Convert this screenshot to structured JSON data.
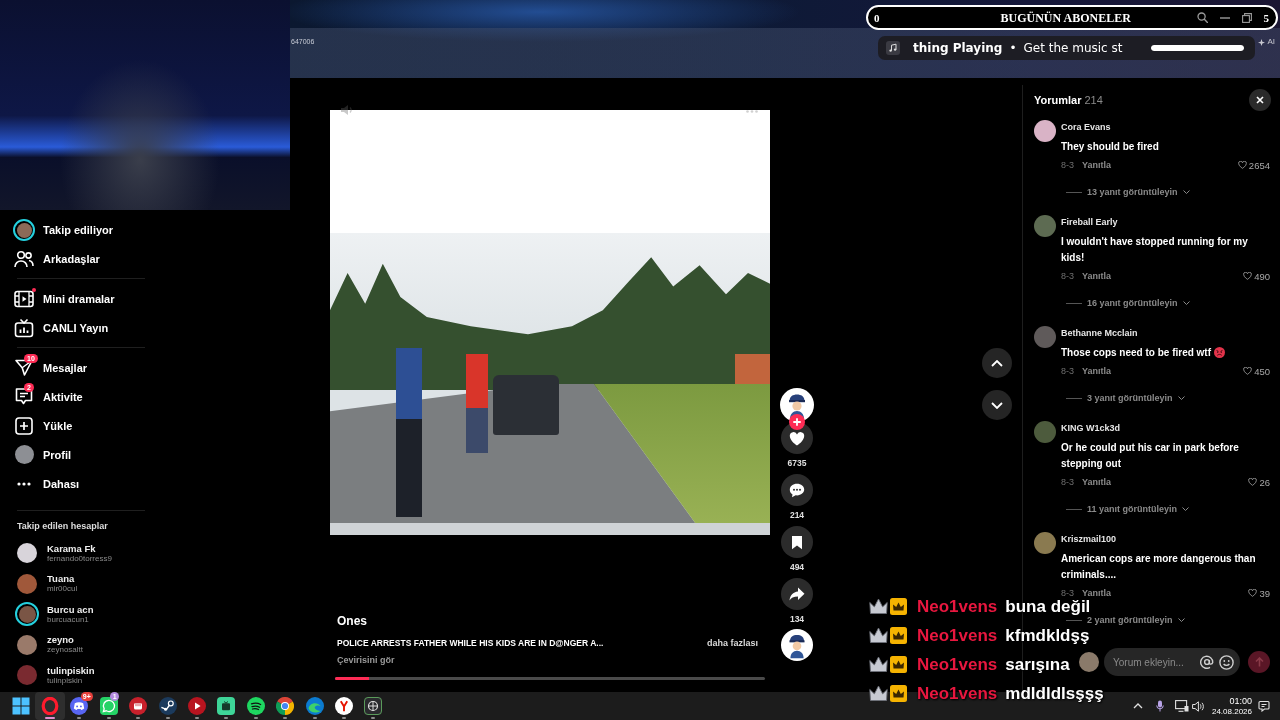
{
  "stream_overlay": {
    "left_count": "0",
    "title": "BUGÜNÜN ABONELER",
    "right_count": "5"
  },
  "music_widget": {
    "title": "thing Playing",
    "separator": "•",
    "subtitle": "Get the music st",
    "level": 1
  },
  "browser": {
    "page_label": "647006",
    "ai_label": "AI"
  },
  "sidebar": {
    "groups": [
      {
        "items": [
          {
            "label": "Takip ediliyor",
            "dot": false
          },
          {
            "label": "Arkadaşlar",
            "dot": false
          }
        ]
      },
      {
        "items": [
          {
            "label": "Mini dramalar",
            "dot": true
          },
          {
            "label": "CANLI Yayın",
            "dot": false
          }
        ]
      },
      {
        "items": [
          {
            "label": "Mesajlar",
            "dot": false,
            "badge": "10"
          },
          {
            "label": "Aktivite",
            "dot": false,
            "badge": "2"
          },
          {
            "label": "Yükle",
            "dot": false
          },
          {
            "label": "Profil",
            "dot": false
          },
          {
            "label": "Dahası",
            "dot": false
          }
        ]
      }
    ],
    "following_title": "Takip edilen hesaplar",
    "accounts": [
      {
        "name": "Karama Fk",
        "handle": "fernando0torress9",
        "story": false
      },
      {
        "name": "Tuana",
        "handle": "mir00cul",
        "story": false
      },
      {
        "name": "Burcu acn",
        "handle": "burcuacun1",
        "story": true
      },
      {
        "name": "zeyno",
        "handle": "zeynosaltt",
        "story": false
      },
      {
        "name": "tulinpiskin",
        "handle": "tulinpiskin",
        "story": false
      }
    ]
  },
  "video": {
    "author": "Ones",
    "description": "POLICE ARRESTS FATHER WHILE HIS KIDS ARE IN D@NGER A...",
    "more_link": "daha fazlası",
    "translate_link": "Çevirisini gör",
    "progress": {
      "level": 0.08
    }
  },
  "actions": [
    {
      "count": "6735"
    },
    {
      "count": "214"
    },
    {
      "count": "494"
    },
    {
      "count": "134"
    }
  ],
  "comments": {
    "title": "Yorumlar",
    "count": "214",
    "items": [
      {
        "author": "Cora Evans",
        "text": "They should be fired",
        "has_emoji": false,
        "date": "8-3",
        "reply": "Yanıtla",
        "likes": "2654",
        "replies": "13 yanıt görüntüleyin"
      },
      {
        "author": "Fireball Early",
        "text": "I wouldn't have stopped running for my kids!",
        "has_emoji": false,
        "date": "8-3",
        "reply": "Yanıtla",
        "likes": "490",
        "replies": "16 yanıt görüntüleyin"
      },
      {
        "author": "Bethanne Mcclain",
        "text": "Those cops need to be fired wtf",
        "has_emoji": true,
        "date": "8-3",
        "reply": "Yanıtla",
        "likes": "450",
        "replies": "3 yanıt görüntüleyin"
      },
      {
        "author": "KING W1ck3d",
        "text": "Or he could put his car in park before stepping out",
        "has_emoji": false,
        "date": "8-3",
        "reply": "Yanıtla",
        "likes": "26",
        "replies": "11 yanıt görüntüleyin"
      },
      {
        "author": "Kriszmail100",
        "text": "American cops are more dangerous than criminals....",
        "has_emoji": false,
        "date": "8-3",
        "reply": "Yanıtla",
        "likes": "39",
        "replies": "2 yanıt görüntüleyin"
      }
    ],
    "input": {
      "placeholder": "Yorum ekleyin..."
    }
  },
  "chat": {
    "messages": [
      {
        "user": "Neo1vens",
        "text": "buna değil"
      },
      {
        "user": "Neo1vens",
        "text": "kfmdkldşş"
      },
      {
        "user": "Neo1vens",
        "text": "sarışına"
      },
      {
        "user": "Neo1vens",
        "text": "mdldldlsşşş"
      }
    ]
  },
  "taskbar": {
    "apps": [
      {
        "selected": true,
        "running": true
      },
      {
        "selected": false,
        "running": true,
        "badge": "9+",
        "color": "#e8413c"
      },
      {
        "selected": false,
        "running": true,
        "badge": "1",
        "color": "#b48be0"
      },
      {
        "selected": false,
        "running": true
      },
      {
        "selected": false,
        "running": true
      },
      {
        "selected": false,
        "running": true
      },
      {
        "selected": false,
        "running": true
      },
      {
        "selected": false,
        "running": true
      },
      {
        "selected": false,
        "running": true
      },
      {
        "selected": false,
        "running": true
      },
      {
        "selected": false,
        "running": true
      },
      {
        "selected": false,
        "running": true
      }
    ],
    "clock": {
      "time": "01:00",
      "date": "24.08.2026"
    }
  }
}
